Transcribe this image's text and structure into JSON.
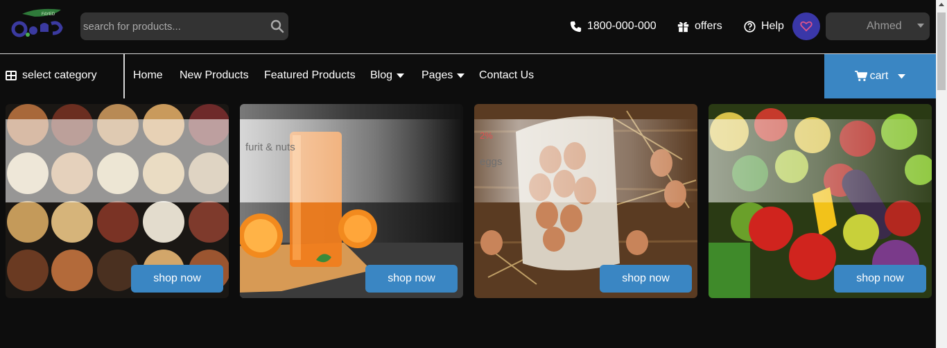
{
  "search": {
    "placeholder": "search for products..."
  },
  "header": {
    "phone": "1800-000-000",
    "offers": "offers",
    "help": "Help",
    "user_name": "Ahmed"
  },
  "nav": {
    "category": "select category",
    "links": [
      "Home",
      "New Products",
      "Featured Products",
      "Blog",
      "Pages",
      "Contact Us"
    ],
    "cart": "cart"
  },
  "cards": [
    {
      "image": "nuts-bowls",
      "title": "",
      "discount": "",
      "button": "shop now"
    },
    {
      "image": "orange-juice",
      "title": "furit & nuts",
      "discount": "",
      "button": "shop now"
    },
    {
      "image": "eggs-basket",
      "title": "eggs",
      "discount": "2%",
      "button": "shop now"
    },
    {
      "image": "vegetables",
      "title": "",
      "discount": "",
      "button": "shop now"
    }
  ],
  "colors": {
    "background": "#0d0d0d",
    "accent": "#3a86c3",
    "heart_button": "#3a37a8",
    "heart": "#e0558a",
    "input_bg": "#333333",
    "discount": "#e05050"
  }
}
